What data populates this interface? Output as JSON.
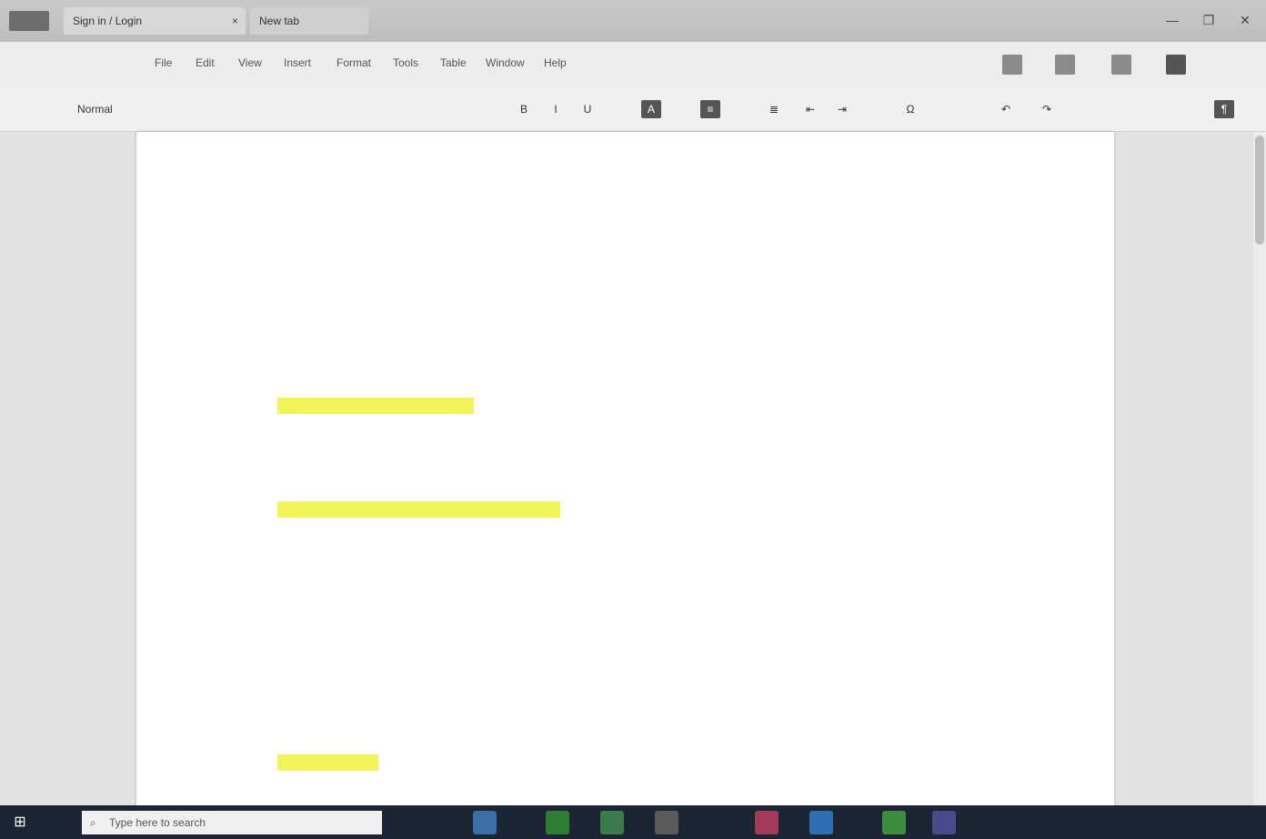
{
  "window": {
    "app_icon": "word-processor-icon",
    "tabs": [
      {
        "label": "Sign in / Login"
      },
      {
        "label": "New tab"
      }
    ],
    "controls": [
      "—",
      "❐",
      "✕"
    ]
  },
  "menubar": {
    "items": [
      "File",
      "Edit",
      "View",
      "Insert",
      "Format",
      "Tools",
      "Table",
      "Window",
      "Help"
    ],
    "icons": [
      "print-icon",
      "share-icon",
      "comment-icon",
      "settings-icon"
    ]
  },
  "toolbar": {
    "style": "Normal",
    "buttons": [
      "B",
      "I",
      "U",
      "A",
      "≡",
      "≣",
      "⇤",
      "⇥",
      "Ω",
      "↶",
      "↷",
      "¶"
    ]
  },
  "document": {
    "header1": "",
    "header2": "",
    "title": "",
    "lines": [
      {
        "text": "",
        "highlight": false
      },
      {
        "text": "",
        "highlight": false
      },
      {
        "text": "",
        "highlight": false
      },
      {
        "text": "",
        "highlight": false
      },
      {
        "text": "",
        "highlight": false
      },
      {
        "text": "",
        "highlight": false
      },
      {
        "text": "",
        "highlight": true
      },
      {
        "text": "",
        "highlight": false
      },
      {
        "text": "",
        "highlight": false
      },
      {
        "text": "",
        "highlight": true
      },
      {
        "text": "",
        "highlight": false
      },
      {
        "text": "",
        "highlight": false
      },
      {
        "text": "",
        "highlight": false
      },
      {
        "text": "",
        "highlight": false
      },
      {
        "text": "",
        "highlight": false
      },
      {
        "text": "",
        "highlight": false
      },
      {
        "text": "",
        "highlight": false
      },
      {
        "text": "",
        "highlight": true
      },
      {
        "text": "",
        "highlight": false
      }
    ]
  },
  "taskbar": {
    "search_placeholder": "Type here to search",
    "clock_time": "",
    "clock_date": ""
  },
  "colors": {
    "highlight": "#f3f35a",
    "taskbar": "#1c2533",
    "page": "#ffffff"
  }
}
